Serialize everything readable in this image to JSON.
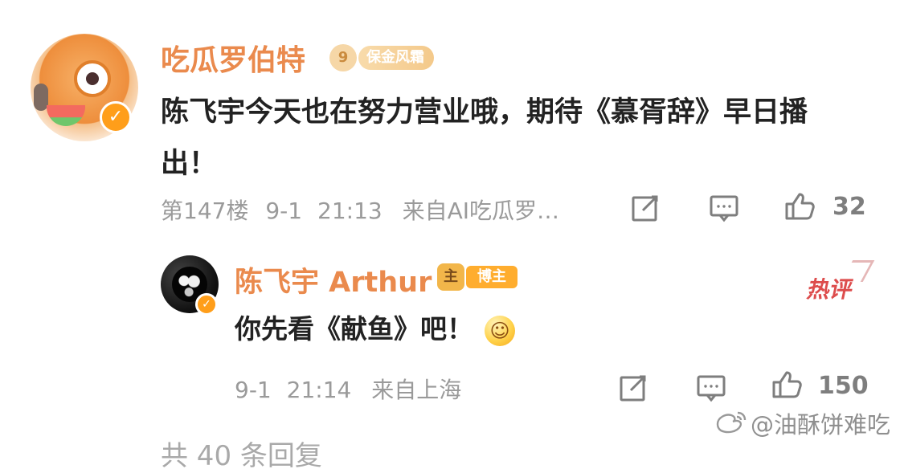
{
  "main_comment": {
    "username": "吃瓜罗伯特",
    "level_badge": "9",
    "fan_badge": "保金风霜",
    "verified_mark": "✓",
    "content": "陈飞宇今天也在努力营业哦，期待《慕胥辞》早日播出！",
    "floor": "第147楼",
    "date": "9-1",
    "time": "21:13",
    "source": "来自AI吃瓜罗…",
    "like_count": "32",
    "icons": {
      "edit": "edit-icon",
      "comment": "comment-icon",
      "like": "thumb-up-icon"
    }
  },
  "reply_comment": {
    "username": "陈飞宇 Arthur",
    "host_icon": "主",
    "host_badge": "博主",
    "verified_mark": "✓",
    "content": "你先看《献鱼》吧！",
    "emoji": "☺",
    "date": "9-1",
    "time": "21:14",
    "source": "来自上海",
    "like_count": "150",
    "hot_tag": "热评",
    "icons": {
      "edit": "edit-icon",
      "comment": "comment-icon",
      "like": "thumb-up-icon"
    }
  },
  "watermark": "@油酥饼难吃",
  "bottom_partial_text": "共 40 条回复"
}
